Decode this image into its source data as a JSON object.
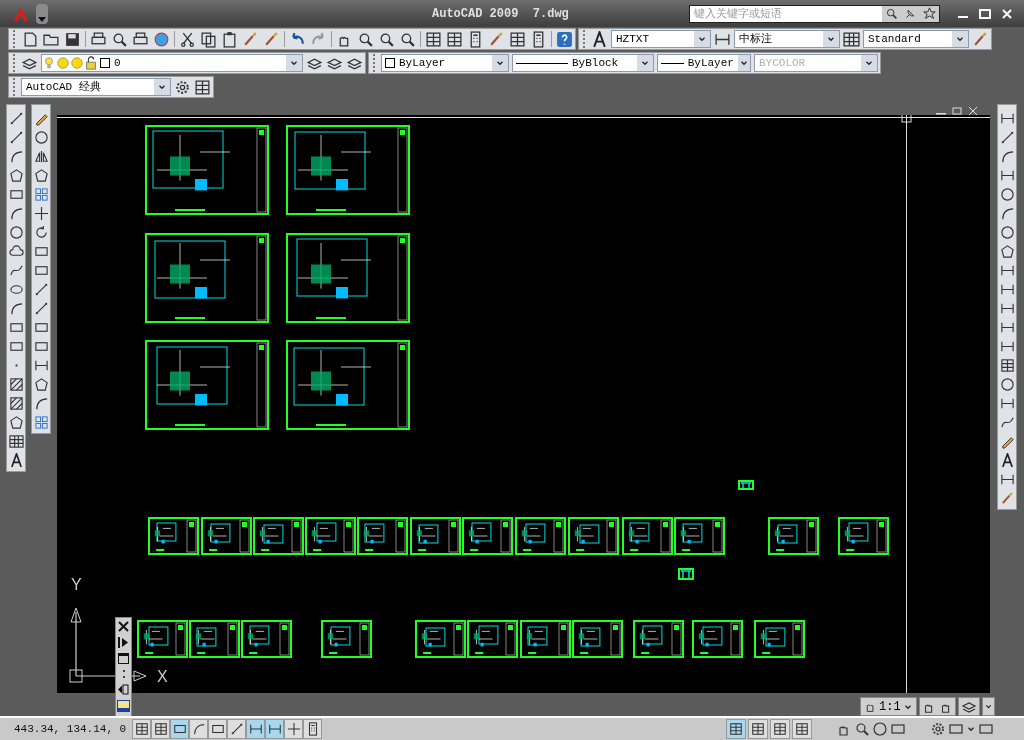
{
  "window": {
    "title": "AutoCAD 2009  7.dwg"
  },
  "search": {
    "placeholder": "键入关键字或短语"
  },
  "styles_toolbar": {
    "text_style": "HZTXT",
    "dim_style": "中标注",
    "table_style": "Standard"
  },
  "layers_toolbar": {
    "current_layer": "0"
  },
  "properties_toolbar": [
    {
      "value": "ByLayer",
      "kind": "color",
      "disabled": false
    },
    {
      "value": "ByBlock",
      "kind": "linetype",
      "disabled": false
    },
    {
      "value": "ByLayer",
      "kind": "linetype",
      "disabled": false
    },
    {
      "value": "BYCOLOR",
      "kind": "plain",
      "disabled": true
    }
  ],
  "workspace": {
    "value": "AutoCAD 经典"
  },
  "ucs": {
    "y_label": "Y",
    "x_label": "X"
  },
  "annotation_scale": "1:1",
  "status_bar": {
    "coordinates": "443.34, 134.14, 0",
    "toggles": [
      {
        "selected": false
      },
      {
        "selected": false
      },
      {
        "selected": true
      },
      {
        "selected": false
      },
      {
        "selected": false
      },
      {
        "selected": false
      },
      {
        "selected": true
      },
      {
        "selected": true
      },
      {
        "selected": false
      },
      {
        "selected": false
      }
    ],
    "space_buttons": [
      {
        "selected": true
      },
      {
        "selected": false
      },
      {
        "selected": false
      },
      {
        "selected": false
      }
    ]
  }
}
